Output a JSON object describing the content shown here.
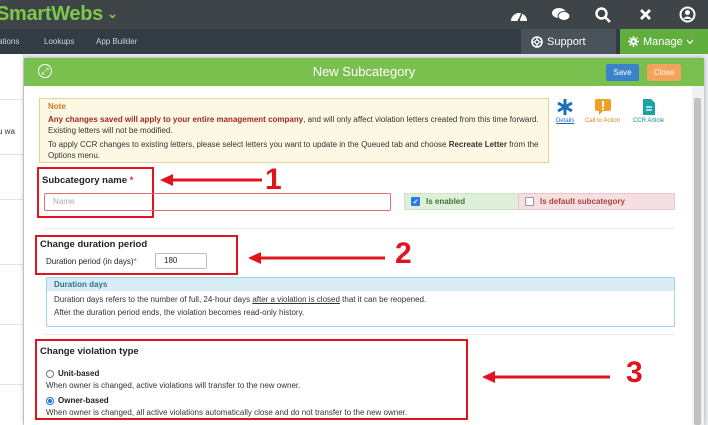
{
  "app": {
    "brand": "SmartWebs",
    "brand_chevron": "⌄"
  },
  "topbar": {
    "icons": [
      "dashboard-icon",
      "chat-icon",
      "search-icon",
      "close-icon",
      "user-icon"
    ]
  },
  "nav": {
    "items": [
      "ations",
      "Lookups",
      "App Builder"
    ],
    "support": "Support",
    "manage": "Manage"
  },
  "background": {
    "cut_text": "u wa"
  },
  "modal": {
    "title": "New Subcategory",
    "save_label": "Save",
    "close_label": "Close",
    "note": {
      "title": "Note",
      "bold_text": "Any changes saved will apply to your entire management company",
      "text1": ", and will only affect violation letters created from this time forward. Existing letters will not be modified.",
      "text2_pre": "To apply CCR changes to existing letters, please select letters you want to update in the Queued tab and choose ",
      "text2_bold": "Recreate Letter",
      "text2_post": " from the Options menu."
    },
    "tools": {
      "details": "Details",
      "call_to_action": "Call to Action",
      "ccr_article": "CCR Article"
    },
    "subcategory": {
      "label": "Subcategory name",
      "required": "*",
      "placeholder": "Name",
      "enabled_label": "Is enabled",
      "default_label": "Is default subcategory"
    },
    "duration": {
      "header": "Change duration period",
      "label": "Duration period (in days)",
      "required": "*",
      "value": "180",
      "info_title": "Duration days",
      "info_pre": "Duration days refers to the number of full, 24-hour days ",
      "info_link": "after a violation is closed",
      "info_post": " that it can be reopened.",
      "info_line2": "After the duration period ends, the violation becomes read-only history."
    },
    "violation_type": {
      "header": "Change violation type",
      "unit_label": "Unit-based",
      "unit_desc": "When owner is changed, active violations will transfer to the new owner.",
      "owner_label": "Owner-based",
      "owner_desc": "When owner is changed, all active violations automatically close and do not transfer to the new owner."
    }
  },
  "annotations": [
    "1",
    "2",
    "3"
  ],
  "colors": {
    "accent_green": "#79c04e",
    "annotation_red": "#e0141e",
    "save_blue": "#3b82c8",
    "close_orange": "#f5a25a"
  }
}
